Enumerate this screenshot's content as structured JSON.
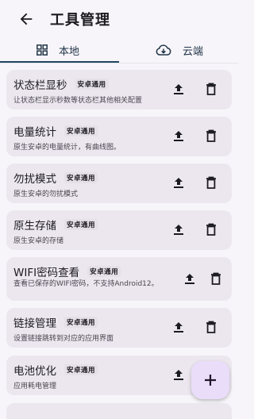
{
  "appbar": {
    "title": "工具管理"
  },
  "tabs": [
    {
      "label": "本地",
      "icon": "grid-icon"
    },
    {
      "label": "云端",
      "icon": "cloud-download-icon"
    }
  ],
  "tools": [
    {
      "title": "状态栏显秒",
      "badge": "安卓通用",
      "desc": "让状态栏显示秒数等状态栏其他相关配置"
    },
    {
      "title": "电量统计",
      "badge": "安卓通用",
      "desc": "原生安卓的电量统计，有曲线图。"
    },
    {
      "title": "勿扰模式",
      "badge": "安卓通用",
      "desc": "原生安卓的勿扰模式"
    },
    {
      "title": "原生存储",
      "badge": "安卓通用",
      "desc": "原生安卓的存储"
    },
    {
      "title": "WIFI密码查看",
      "badge": "安卓通用",
      "desc": "查看已保存的WIFI密码，不支持Android12。"
    },
    {
      "title": "链接管理",
      "badge": "安卓通用",
      "desc": "设置链接跳转到对应的应用界面"
    },
    {
      "title": "电池优化",
      "badge": "安卓通用",
      "desc": "应用耗电管理"
    }
  ],
  "fab": {
    "icon": "plus-icon"
  }
}
